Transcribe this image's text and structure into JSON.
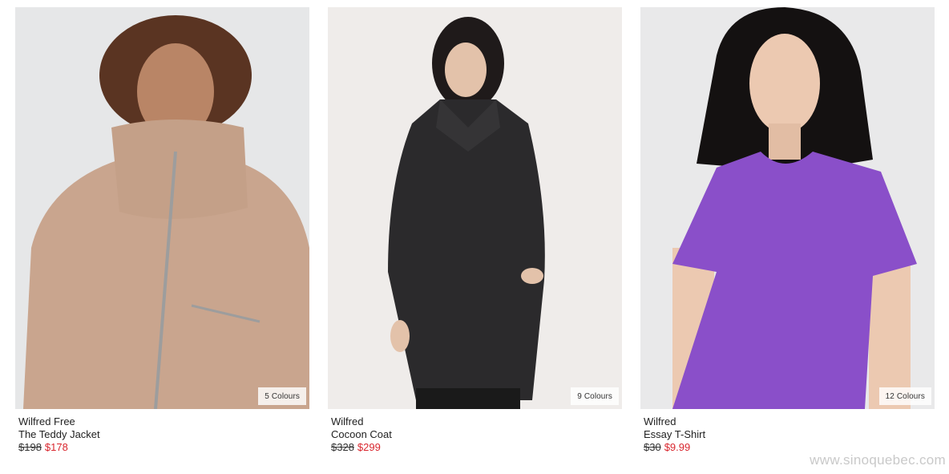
{
  "products": [
    {
      "brand": "Wilfred Free",
      "name": "The Teddy Jacket",
      "original_price": "$198",
      "sale_price": "$178",
      "colours": "5 Colours"
    },
    {
      "brand": "Wilfred",
      "name": "Cocoon Coat",
      "original_price": "$328",
      "sale_price": "$299",
      "colours": "9 Colours"
    },
    {
      "brand": "Wilfred",
      "name": "Essay T-Shirt",
      "original_price": "$30",
      "sale_price": "$9.99",
      "colours": "12 Colours"
    }
  ],
  "watermark": "www.sinoquebec.com",
  "colors": {
    "sale": "#d9262e",
    "image_bg": "#ece9e6",
    "teddy": "#c9a58e",
    "coat": "#2b2a2c",
    "tshirt": "#8a4fc9"
  }
}
